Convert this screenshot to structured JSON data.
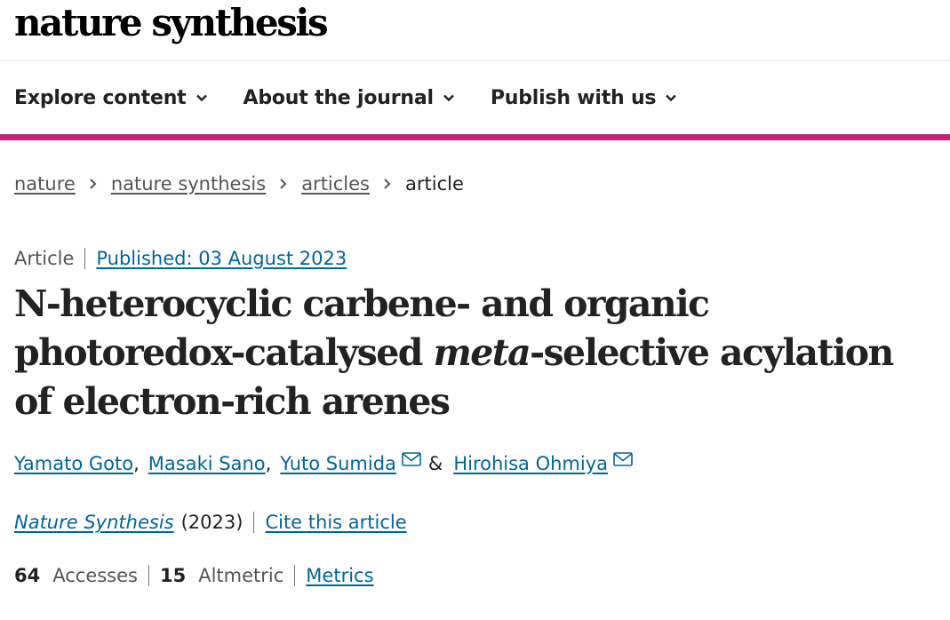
{
  "brand": {
    "logo_text": "nature synthesis"
  },
  "nav": {
    "items": [
      {
        "label": "Explore content"
      },
      {
        "label": "About the journal"
      },
      {
        "label": "Publish with us"
      }
    ],
    "accent_color": "#c42378"
  },
  "breadcrumb": {
    "items": [
      "nature",
      "nature synthesis",
      "articles"
    ],
    "current": "article"
  },
  "article": {
    "type": "Article",
    "published": "Published: 03 August 2023",
    "title_part1": "N-heterocyclic carbene- and organic photoredox-catalysed ",
    "title_italic": "meta",
    "title_part2": "-selective acylation of electron-rich arenes",
    "authors": [
      "Yamato Goto",
      "Masaki Sano",
      "Yuto Sumida",
      "Hirohisa Ohmiya"
    ],
    "author_sep": ",",
    "author_amp": "&",
    "journal": "Nature Synthesis",
    "year": "(2023)",
    "cite_label": "Cite this article"
  },
  "metrics": {
    "accesses_count": "64",
    "accesses_label": "Accesses",
    "altmetric_count": "15",
    "altmetric_label": "Altmetric",
    "link_label": "Metrics"
  },
  "colors": {
    "link": "#006699",
    "text": "#222222",
    "muted": "#555555"
  }
}
